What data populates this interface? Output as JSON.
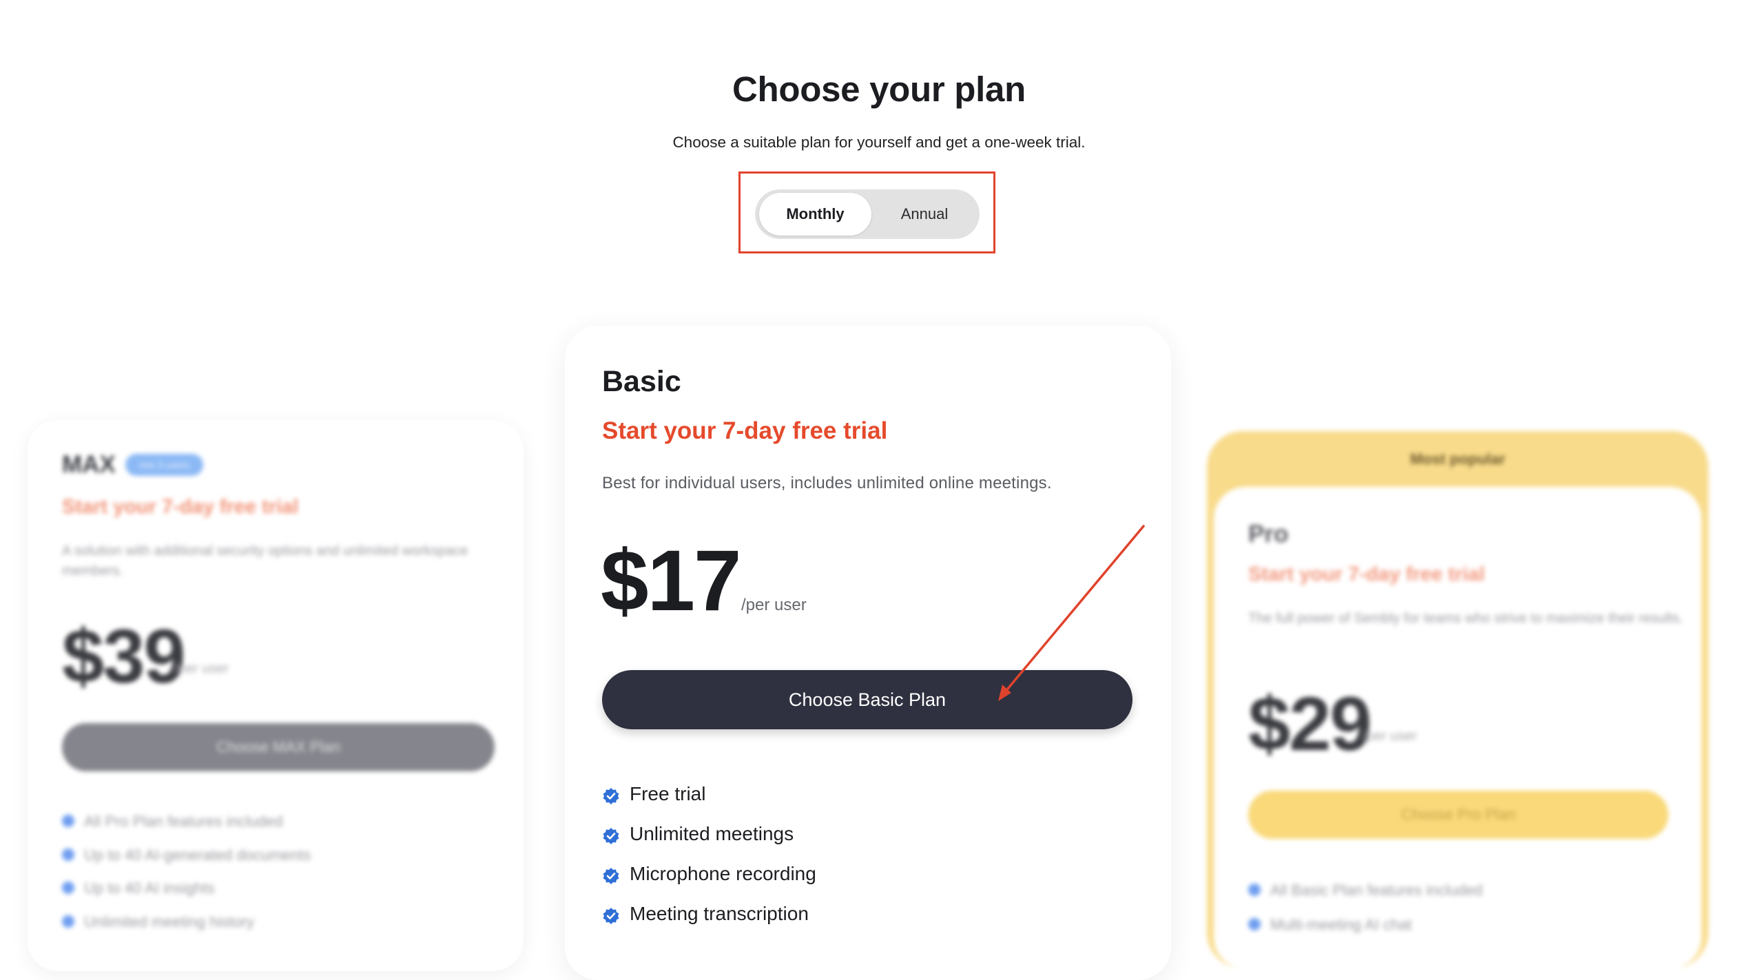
{
  "header": {
    "title": "Choose your plan",
    "subtitle": "Choose a suitable plan for yourself and get a one-week trial."
  },
  "billing_toggle": {
    "options": [
      "Monthly",
      "Annual"
    ],
    "selected": "Monthly"
  },
  "plans": {
    "max": {
      "name": "MAX",
      "badge": "min 3 users",
      "trial": "Start your 7-day free trial",
      "description": "A solution with additional security options and unlimited workspace members.",
      "price": "$39",
      "per": "/per user",
      "button": "Choose MAX Plan",
      "features": [
        "All Pro Plan features included",
        "Up to 40 AI-generated documents",
        "Up to 40 AI insights",
        "Unlimited meeting history"
      ]
    },
    "basic": {
      "name": "Basic",
      "trial": "Start your 7-day free trial",
      "description": "Best for individual users, includes unlimited online meetings.",
      "price": "$17",
      "per": "/per user",
      "button": "Choose Basic Plan",
      "features": [
        "Free trial",
        "Unlimited meetings",
        "Microphone recording",
        "Meeting transcription"
      ]
    },
    "pro": {
      "ribbon": "Most popular",
      "name": "Pro",
      "trial": "Start your 7-day free trial",
      "description": "The full power of Sembly for teams who strive to maximize their results.",
      "price": "$29",
      "per": "/per user",
      "button": "Choose Pro Plan",
      "features": [
        "All Basic Plan features included",
        "Multi-meeting AI chat"
      ]
    }
  },
  "colors": {
    "accent_red": "#e54a2c",
    "dark_button": "#2f3140",
    "check_blue": "#2f6fd6",
    "pro_yellow": "#f8db8b"
  },
  "icons": {
    "feature_check": "verified-check-badge-icon",
    "annotation": "red-arrow"
  }
}
